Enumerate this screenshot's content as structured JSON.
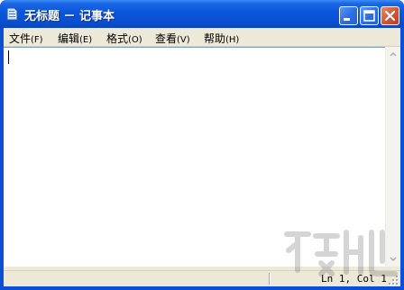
{
  "window": {
    "title": "无标题 － 记事本"
  },
  "menubar": {
    "items": [
      {
        "label": "文件",
        "accel": "(F)"
      },
      {
        "label": "编辑",
        "accel": "(E)"
      },
      {
        "label": "格式",
        "accel": "(O)"
      },
      {
        "label": "查看",
        "accel": "(V)"
      },
      {
        "label": "帮助",
        "accel": "(H)"
      }
    ]
  },
  "editor": {
    "content": ""
  },
  "statusbar": {
    "position": "Ln 1, Col 1"
  },
  "icons": {
    "app": "notepad-icon",
    "minimize": "minimize-icon",
    "maximize": "maximize-icon",
    "close": "close-icon"
  },
  "colors": {
    "titlebar": "#0a56dc",
    "menubar": "#ece9d8",
    "close_button": "#d5532f"
  }
}
